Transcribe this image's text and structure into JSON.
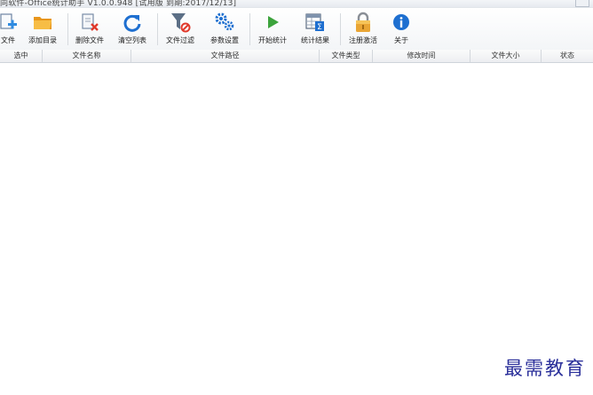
{
  "window": {
    "title": "同软件-Office统计助手 V1.0.0.948 [试用版 到期:2017/12/13]"
  },
  "toolbar": {
    "items": [
      {
        "label": "文件",
        "icon": "add-file-icon"
      },
      {
        "label": "添加目录",
        "icon": "folder-icon"
      },
      {
        "label": "删除文件",
        "icon": "delete-file-icon"
      },
      {
        "label": "清空列表",
        "icon": "refresh-icon"
      },
      {
        "label": "文件过滤",
        "icon": "filter-icon"
      },
      {
        "label": "参数设置",
        "icon": "gears-icon"
      },
      {
        "label": "开始统计",
        "icon": "play-icon"
      },
      {
        "label": "统计结果",
        "icon": "table-sum-icon"
      },
      {
        "label": "注册激活",
        "icon": "lock-icon"
      },
      {
        "label": "关于",
        "icon": "info-icon"
      }
    ]
  },
  "grid": {
    "columns": [
      "选中",
      "文件名称",
      "文件路径",
      "文件类型",
      "修改时间",
      "文件大小",
      "状态"
    ],
    "rows": []
  },
  "watermark": "最需教育",
  "colors": {
    "accent_blue": "#1e6fd0",
    "folder_orange": "#f0a92a",
    "play_green": "#3ca33c",
    "watermark_blue": "#2a2f9a"
  }
}
